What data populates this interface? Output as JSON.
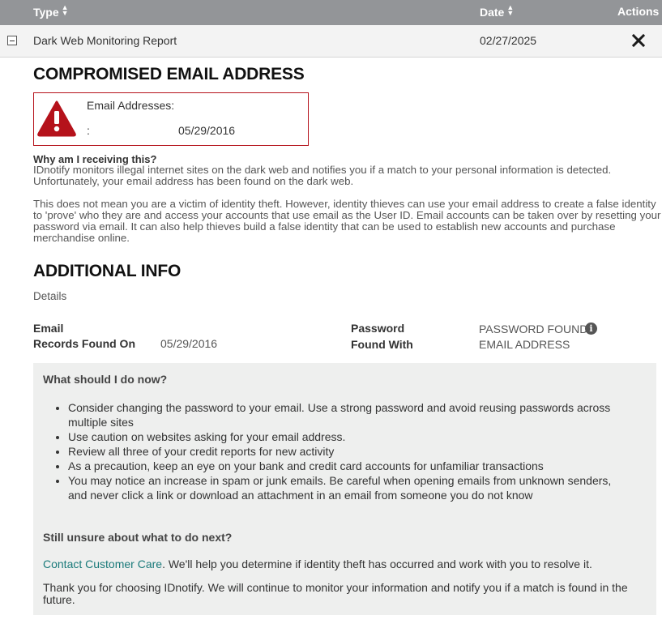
{
  "table_header": {
    "type_label": "Type",
    "date_label": "Date",
    "actions_label": "Actions"
  },
  "report_row": {
    "type": "Dark Web Monitoring Report",
    "date": "02/27/2025"
  },
  "compromised": {
    "heading": "COMPROMISED EMAIL ADDRESS",
    "label": "Email Addresses:",
    "colon": ":",
    "date": "05/29/2016"
  },
  "why": {
    "question": "Why am I receiving this?",
    "para1": "IDnotify monitors illegal internet sites on the dark web and notifies you if a match to your personal information is detected. Unfortunately, your email address has been found on the dark web.",
    "para2": "This does not mean you are a victim of identity theft. However, identity thieves can use your email address to create a false identity to 'prove' who they are and access your accounts that use email as the User ID. Email accounts can be taken over by resetting your password via email. It can also help thieves build a false identity that can be used to establish new accounts and purchase merchandise online."
  },
  "additional": {
    "heading": "ADDITIONAL INFO",
    "details": "Details",
    "email_label": "Email",
    "records_label": "Records Found On",
    "records_value": "05/29/2016",
    "password_label": "Password",
    "password_value": "PASSWORD FOUND",
    "found_with_label": "Found With",
    "found_with_value": "EMAIL ADDRESS"
  },
  "advice": {
    "heading": "What should I do now?",
    "tips": [
      "Consider changing the password to your email. Use a strong password and avoid reusing passwords across multiple sites",
      "Use caution on websites asking for your email address.",
      "Review all three of your credit reports for new activity",
      "As a precaution, keep an eye on your bank and credit card accounts for unfamiliar transactions",
      "You may notice an increase in spam or junk emails. Be careful when opening emails from unknown senders, and never click a link or download an attachment in an email from someone you do not know"
    ],
    "unsure_heading": "Still unsure about what to do next?",
    "contact_link": "Contact Customer Care",
    "contact_text": ". We'll help you determine if identity theft has occurred and work with you to resolve it.",
    "thanks": "Thank you for choosing IDnotify. We will continue to monitor your information and notify you if a match is found in the future."
  },
  "colors": {
    "header_bg": "#939598",
    "alert_red": "#b5121b",
    "link_teal": "#1a7a7a",
    "panel_bg": "#eeefee"
  },
  "icons": [
    "sort-icon",
    "collapse-icon",
    "close-icon",
    "warning-icon",
    "info-icon"
  ]
}
